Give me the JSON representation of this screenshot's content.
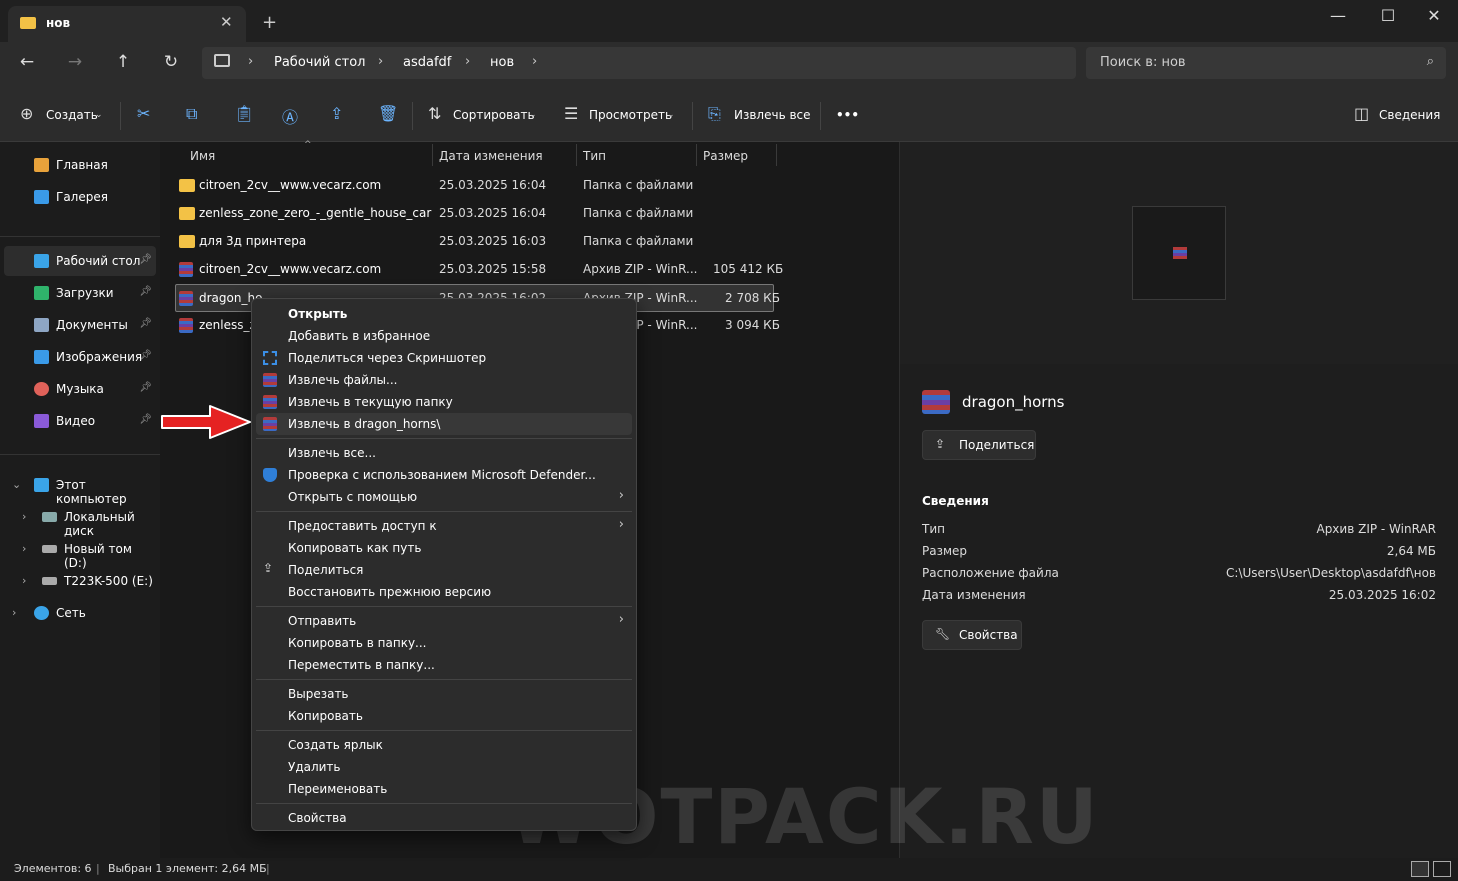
{
  "window": {
    "tab_title": "нов",
    "tab_close": "✕",
    "new_tab": "+",
    "minimize": "—",
    "maximize": "☐",
    "close": "✕"
  },
  "address": {
    "crumbs": [
      "Рабочий стол",
      "asdafdf",
      "нов"
    ],
    "sep": "›",
    "search_placeholder": "Поиск в: нов"
  },
  "toolbar": {
    "create": "Создать",
    "sort": "Сортировать",
    "view": "Просмотреть",
    "extract_all": "Извлечь все",
    "more": "•••",
    "details": "Сведения"
  },
  "sidebar": {
    "items": [
      {
        "label": "Главная",
        "icon": "home-icon",
        "color": "#e8a23b"
      },
      {
        "label": "Галерея",
        "icon": "gallery-icon",
        "color": "#3a9ae8"
      },
      {
        "label": "Рабочий стол",
        "icon": "desktop-icon",
        "color": "#3aa4e8"
      },
      {
        "label": "Загрузки",
        "icon": "download-icon",
        "color": "#2fb36b"
      },
      {
        "label": "Документы",
        "icon": "documents-icon",
        "color": "#8ea6c4"
      },
      {
        "label": "Изображения",
        "icon": "pictures-icon",
        "color": "#3a9ae8"
      },
      {
        "label": "Музыка",
        "icon": "music-icon",
        "color": "#e0625a"
      },
      {
        "label": "Видео",
        "icon": "video-icon",
        "color": "#8a5ad8"
      }
    ],
    "tree": [
      {
        "label": "Этот компьютер",
        "icon": "computer-icon",
        "color": "#3aa4e8"
      },
      {
        "label": "Локальный диск",
        "icon": "drive-icon",
        "color": "#8aa"
      },
      {
        "label": "Новый том (D:)",
        "icon": "drive-icon",
        "color": "#aaa"
      },
      {
        "label": "T223K-500 (E:)",
        "icon": "drive-icon",
        "color": "#aaa"
      },
      {
        "label": "Сеть",
        "icon": "network-icon",
        "color": "#3aa4e8"
      }
    ]
  },
  "filelist": {
    "columns": [
      "Имя",
      "Дата изменения",
      "Тип",
      "Размер"
    ],
    "rows": [
      {
        "name": "citroen_2cv__www.vecarz.com",
        "date": "25.03.2025 16:04",
        "type": "Папка с файлами",
        "size": "",
        "kind": "folder"
      },
      {
        "name": "zenless_zone_zero_-_gentle_house_car",
        "date": "25.03.2025 16:04",
        "type": "Папка с файлами",
        "size": "",
        "kind": "folder"
      },
      {
        "name": "для 3д принтера",
        "date": "25.03.2025 16:03",
        "type": "Папка с файлами",
        "size": "",
        "kind": "folder"
      },
      {
        "name": "citroen_2cv__www.vecarz.com",
        "date": "25.03.2025 15:58",
        "type": "Архив ZIP - WinR...",
        "size": "105 412 КБ",
        "kind": "rar"
      },
      {
        "name": "dragon_ho",
        "date": "25.03.2025 16:02",
        "type": "Архив ZIP - WinR...",
        "size": "2 708 КБ",
        "kind": "rar"
      },
      {
        "name": "zenless_zc",
        "date": "",
        "type": "Архив ZIP - WinR...",
        "size": "3 094 КБ",
        "kind": "rar"
      }
    ]
  },
  "context_menu": {
    "items": [
      "Открыть",
      "Добавить в избранное",
      "Поделиться через Скриншотер",
      "Извлечь файлы...",
      "Извлечь в текущую папку",
      "Извлечь в dragon_horns\\",
      "Извлечь все...",
      "Проверка с использованием Microsoft Defender...",
      "Открыть с помощью",
      "Предоставить доступ к",
      "Копировать как путь",
      "Поделиться",
      "Восстановить прежнюю версию",
      "Отправить",
      "Копировать в папку...",
      "Переместить в папку...",
      "Вырезать",
      "Копировать",
      "Создать ярлык",
      "Удалить",
      "Переименовать",
      "Свойства"
    ],
    "submenu_arrow": "›"
  },
  "details": {
    "filename": "dragon_horns",
    "share": "Поделиться",
    "section": "Сведения",
    "rows": [
      {
        "label": "Тип",
        "value": "Архив ZIP - WinRAR"
      },
      {
        "label": "Размер",
        "value": "2,64 МБ"
      },
      {
        "label": "Расположение файла",
        "value": "C:\\Users\\User\\Desktop\\asdafdf\\нов"
      },
      {
        "label": "Дата изменения",
        "value": "25.03.2025 16:02"
      }
    ],
    "properties": "Свойства"
  },
  "status": {
    "count": "Элементов: 6",
    "selected": "Выбран 1 элемент: 2,64 МБ",
    "bar": "|"
  },
  "watermark": "WOTPACK.RU",
  "colors": {
    "accent": "#6cb5ff",
    "arrow": "#e52222"
  }
}
